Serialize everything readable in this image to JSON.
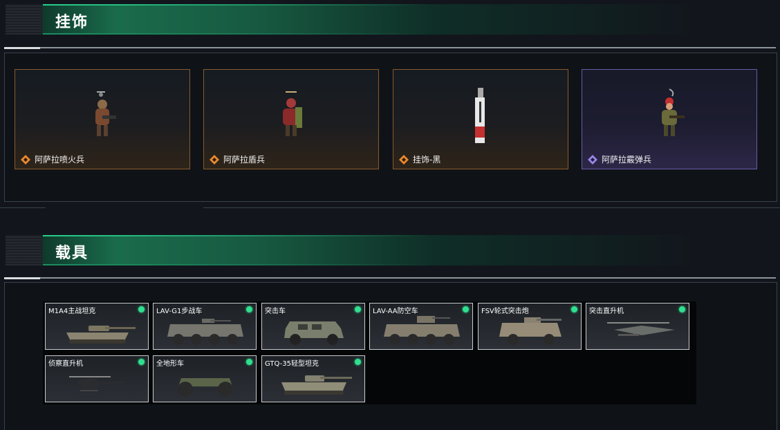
{
  "sections": {
    "pendants": {
      "title": "挂饰"
    },
    "vehicles": {
      "title": "载具"
    }
  },
  "pendants": [
    {
      "name": "阿萨拉喷火兵",
      "rarity_icon": "orange-diamond-icon",
      "rarity_color": "#e8892f"
    },
    {
      "name": "阿萨拉盾兵",
      "rarity_icon": "orange-diamond-icon",
      "rarity_color": "#e8892f"
    },
    {
      "name": "挂饰-黑",
      "rarity_icon": "orange-diamond-icon",
      "rarity_color": "#e8892f"
    },
    {
      "name": "阿萨拉霰弹兵",
      "rarity_icon": "purple-diamond-icon",
      "rarity_color": "#9b84e8"
    }
  ],
  "vehicles": [
    {
      "name": "M1A4主战坦克",
      "status_color": "#2fe08f"
    },
    {
      "name": "LAV-G1步战车",
      "status_color": "#2fe08f"
    },
    {
      "name": "突击车",
      "status_color": "#2fe08f"
    },
    {
      "name": "LAV-AA防空车",
      "status_color": "#2fe08f"
    },
    {
      "name": "FSV轮式突击炮",
      "status_color": "#2fe08f"
    },
    {
      "name": "突击直升机",
      "status_color": "#2fe08f"
    },
    {
      "name": "侦察直升机",
      "status_color": "#2fe08f"
    },
    {
      "name": "全地形车",
      "status_color": "#2fe08f"
    },
    {
      "name": "GTQ-35轻型坦克",
      "status_color": "#2fe08f"
    }
  ],
  "colors": {
    "accent_green": "#1a6b4c",
    "rarity_orange": "#e8892f",
    "rarity_purple": "#9b84e8",
    "status_green": "#2fe08f"
  }
}
